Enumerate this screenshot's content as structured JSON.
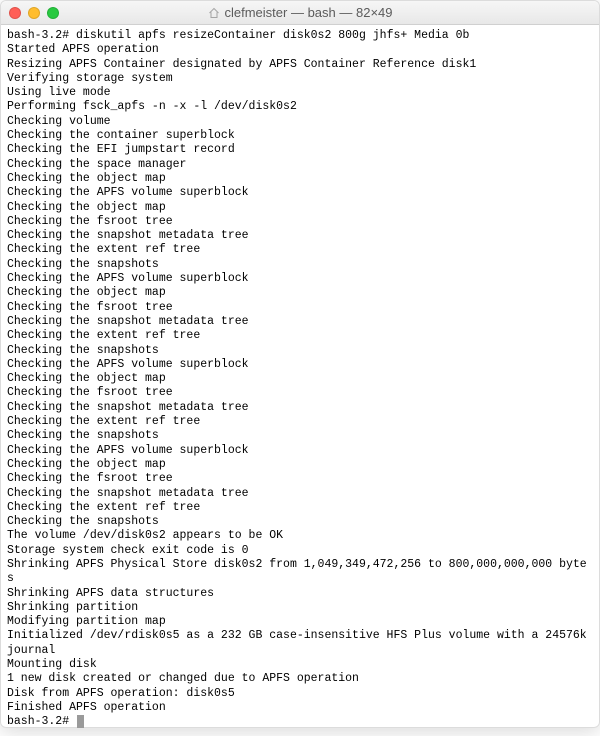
{
  "window": {
    "title": "clefmeister — bash — 82×49"
  },
  "terminal": {
    "prompt1": "bash-3.2# ",
    "command": "diskutil apfs resizeContainer disk0s2 800g jhfs+ Media 0b",
    "lines": [
      "Started APFS operation",
      "Resizing APFS Container designated by APFS Container Reference disk1",
      "Verifying storage system",
      "Using live mode",
      "Performing fsck_apfs -n -x -l /dev/disk0s2",
      "Checking volume",
      "Checking the container superblock",
      "Checking the EFI jumpstart record",
      "Checking the space manager",
      "Checking the object map",
      "Checking the APFS volume superblock",
      "Checking the object map",
      "Checking the fsroot tree",
      "Checking the snapshot metadata tree",
      "Checking the extent ref tree",
      "Checking the snapshots",
      "Checking the APFS volume superblock",
      "Checking the object map",
      "Checking the fsroot tree",
      "Checking the snapshot metadata tree",
      "Checking the extent ref tree",
      "Checking the snapshots",
      "Checking the APFS volume superblock",
      "Checking the object map",
      "Checking the fsroot tree",
      "Checking the snapshot metadata tree",
      "Checking the extent ref tree",
      "Checking the snapshots",
      "Checking the APFS volume superblock",
      "Checking the object map",
      "Checking the fsroot tree",
      "Checking the snapshot metadata tree",
      "Checking the extent ref tree",
      "Checking the snapshots",
      "The volume /dev/disk0s2 appears to be OK",
      "Storage system check exit code is 0",
      "Shrinking APFS Physical Store disk0s2 from 1,049,349,472,256 to 800,000,000,000 bytes",
      "Shrinking APFS data structures",
      "Shrinking partition",
      "Modifying partition map",
      "Initialized /dev/rdisk0s5 as a 232 GB case-insensitive HFS Plus volume with a 24576k journal",
      "Mounting disk",
      "1 new disk created or changed due to APFS operation",
      "Disk from APFS operation: disk0s5",
      "Finished APFS operation"
    ],
    "prompt2": "bash-3.2# "
  }
}
